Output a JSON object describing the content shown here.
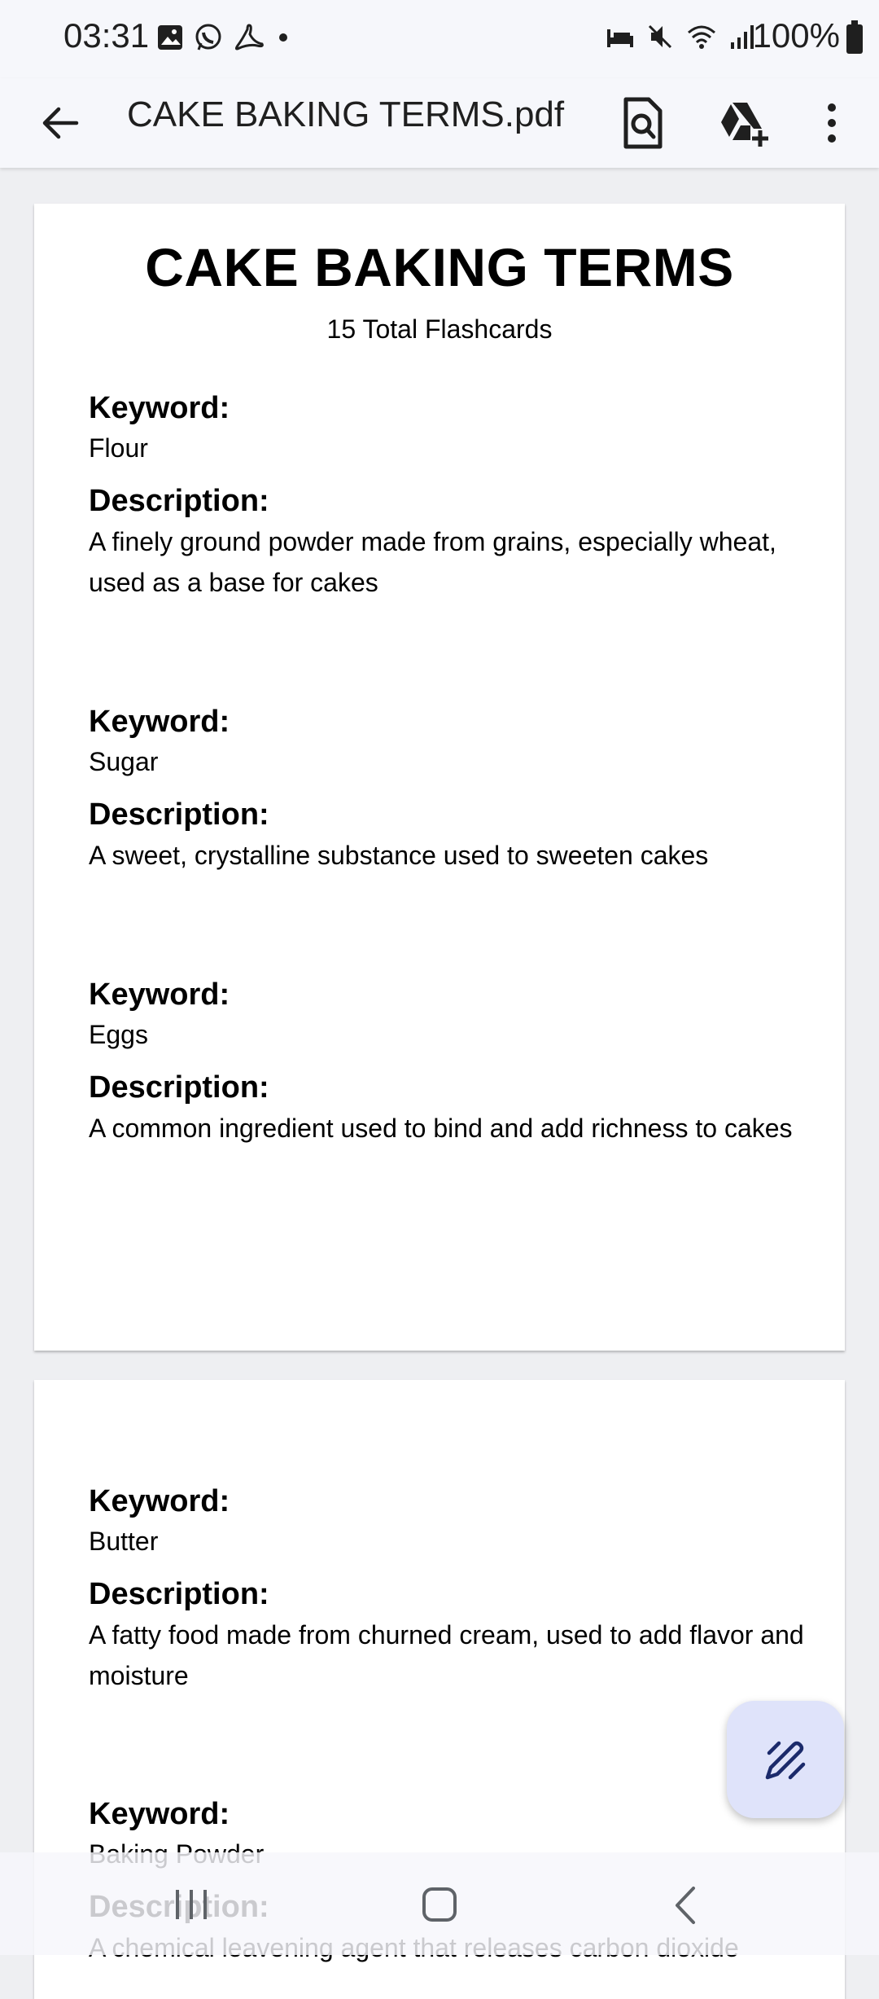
{
  "status_bar": {
    "time": "03:31",
    "battery_text": "100%",
    "left_icons": [
      "gallery-icon",
      "whatsapp-icon",
      "acrobat-icon",
      "dot-icon"
    ],
    "right_icons": [
      "sleep-icon",
      "mute-icon",
      "wifi-icon",
      "signal-icon",
      "battery-icon"
    ]
  },
  "app_bar": {
    "title": "CAKE BAKING TERMS.pdf",
    "actions": [
      "back-arrow-icon",
      "find-in-document-icon",
      "add-to-drive-icon",
      "more-vert-icon"
    ]
  },
  "document": {
    "title": "CAKE BAKING TERMS",
    "subtitle": "15 Total Flashcards",
    "keyword_label": "Keyword:",
    "description_label": "Description:",
    "entries": [
      {
        "keyword": "Flour",
        "description": "A finely ground powder made from grains, especially wheat, used as a base for cakes"
      },
      {
        "keyword": "Sugar",
        "description": "A sweet, crystalline substance used to sweeten cakes"
      },
      {
        "keyword": "Eggs",
        "description": "A common ingredient used to bind and add richness to cakes"
      },
      {
        "keyword": "Butter",
        "description": "A fatty food made from churned cream, used to add flavor and moisture"
      },
      {
        "keyword": "Baking Powder",
        "description": "A chemical leavening agent that releases carbon dioxide"
      }
    ]
  },
  "fab": {
    "icon": "edit-pen-icon"
  },
  "nav_bar": {
    "icons": [
      "recents-icon",
      "home-icon",
      "back-icon"
    ]
  },
  "colors": {
    "app_bar_bg": "#f6f7fb",
    "page_bg": "#eeeff2",
    "fab_bg": "#dfe3fa",
    "fab_icon": "#1b2a6b"
  }
}
